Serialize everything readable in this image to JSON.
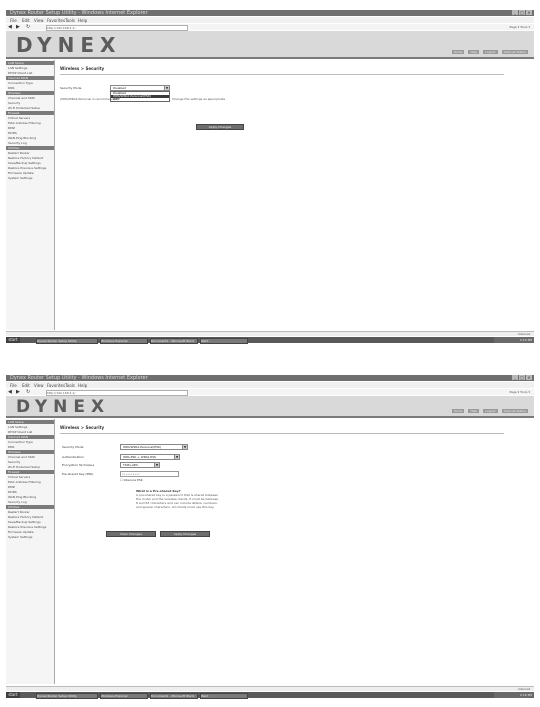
{
  "screenshots": [
    {
      "window_title": "Dynex Router Setup Utility - Windows Internet Explorer",
      "window_buttons": [
        "_",
        "□",
        "×"
      ],
      "menu": [
        "File",
        "Edit",
        "View",
        "Favorites",
        "Tools",
        "Help"
      ],
      "address": "http://192.168.2.1/",
      "toolbar_tools": "Page ▾  Tools ▾",
      "logo": "DYNEX",
      "util_links": [
        "Home",
        "Help",
        "Logout",
        "Internet Status"
      ],
      "sidebar": [
        {
          "label": "LAN Setup",
          "header": true
        },
        {
          "label": "LAN Settings",
          "header": false
        },
        {
          "label": "DHCP Client List",
          "header": false
        },
        {
          "label": "Internet WAN",
          "header": true
        },
        {
          "label": "Connection Type",
          "header": false
        },
        {
          "label": "DNS",
          "header": false
        },
        {
          "label": "Wireless",
          "header": true
        },
        {
          "label": "Channel and SSID",
          "header": false
        },
        {
          "label": "Security",
          "header": false
        },
        {
          "label": "Wi-Fi Protected Setup",
          "header": false
        },
        {
          "label": "Firewall",
          "header": true
        },
        {
          "label": "Virtual Servers",
          "header": false
        },
        {
          "label": "MAC Address Filtering",
          "header": false
        },
        {
          "label": "DMZ",
          "header": false
        },
        {
          "label": "DDNS",
          "header": false
        },
        {
          "label": "WAN Ping Blocking",
          "header": false
        },
        {
          "label": "Security Log",
          "header": false
        },
        {
          "label": "Utilities",
          "header": true
        },
        {
          "label": "Restart Router",
          "header": false
        },
        {
          "label": "Restore Factory Default",
          "header": false
        },
        {
          "label": "Save/Backup Settings",
          "header": false
        },
        {
          "label": "Restore Previous Settings",
          "header": false
        },
        {
          "label": "Firmware Update",
          "header": false
        },
        {
          "label": "System Settings",
          "header": false
        }
      ],
      "page_title": "Wireless > Security",
      "security_mode_label": "Security Mode",
      "security_mode_value": "Disabled",
      "dropdown_options": [
        "Disabled",
        "WPA/WPA2-Personal(PSK)",
        "WEP"
      ],
      "dropdown_selected_index": 1,
      "note_left": "(WPA/WPA2-Personal is recommended)",
      "note_right": "Change the settings as appropriate",
      "apply_button": "Apply Changes",
      "status_text": "Internet",
      "taskbar_start": "start",
      "taskbar_buttons": [
        "Dynex Router Setup Utility",
        "Windows Explorer",
        "Document1 - Microsoft Word",
        "Paint"
      ],
      "clock": "2:15 PM"
    },
    {
      "window_title": "Dynex Router Setup Utility - Windows Internet Explorer",
      "window_buttons": [
        "_",
        "□",
        "×"
      ],
      "menu": [
        "File",
        "Edit",
        "View",
        "Favorites",
        "Tools",
        "Help"
      ],
      "address": "http://192.168.2.1/",
      "toolbar_tools": "Page ▾  Tools ▾",
      "logo": "DYNEX",
      "util_links": [
        "Home",
        "Help",
        "Logout",
        "Internet Status"
      ],
      "sidebar": [
        {
          "label": "LAN Setup",
          "header": true
        },
        {
          "label": "LAN Settings",
          "header": false
        },
        {
          "label": "DHCP Client List",
          "header": false
        },
        {
          "label": "Internet WAN",
          "header": true
        },
        {
          "label": "Connection Type",
          "header": false
        },
        {
          "label": "DNS",
          "header": false
        },
        {
          "label": "Wireless",
          "header": true
        },
        {
          "label": "Channel and SSID",
          "header": false
        },
        {
          "label": "Security",
          "header": false
        },
        {
          "label": "Wi-Fi Protected Setup",
          "header": false
        },
        {
          "label": "Firewall",
          "header": true
        },
        {
          "label": "Virtual Servers",
          "header": false
        },
        {
          "label": "MAC Address Filtering",
          "header": false
        },
        {
          "label": "DMZ",
          "header": false
        },
        {
          "label": "DDNS",
          "header": false
        },
        {
          "label": "WAN Ping Blocking",
          "header": false
        },
        {
          "label": "Security Log",
          "header": false
        },
        {
          "label": "Utilities",
          "header": true
        },
        {
          "label": "Restart Router",
          "header": false
        },
        {
          "label": "Restore Factory Default",
          "header": false
        },
        {
          "label": "Save/Backup Settings",
          "header": false
        },
        {
          "label": "Restore Previous Settings",
          "header": false
        },
        {
          "label": "Firmware Update",
          "header": false
        },
        {
          "label": "System Settings",
          "header": false
        }
      ],
      "page_title": "Wireless > Security",
      "fields": [
        {
          "label": "Security Mode",
          "value": "WPA/WPA2-Personal(PSK)"
        },
        {
          "label": "Authentication",
          "value": "WPA-PSK + WPA2-PSK"
        },
        {
          "label": "Encryption Technique",
          "value": "TKIP+AES"
        },
        {
          "label": "Pre-shared Key (PSK)",
          "value": "••••••••••"
        }
      ],
      "obscure_label": "Obscure PSK",
      "psk_note_title": "What is a Pre-shared Key?",
      "psk_note_lines": [
        "A pre-shared key is a password that is shared between",
        "the router and the wireless clients. It must be between",
        "8 and 63 characters and can include letters, numbers,",
        "and special characters. All clients must use this key."
      ],
      "clear_button": "Clear Changes",
      "apply_button": "Apply Changes",
      "status_text": "Internet",
      "taskbar_start": "start",
      "taskbar_buttons": [
        "Dynex Router Setup Utility",
        "Windows Explorer",
        "Document1 - Microsoft Word",
        "Paint"
      ],
      "clock": "2:16 PM"
    }
  ]
}
